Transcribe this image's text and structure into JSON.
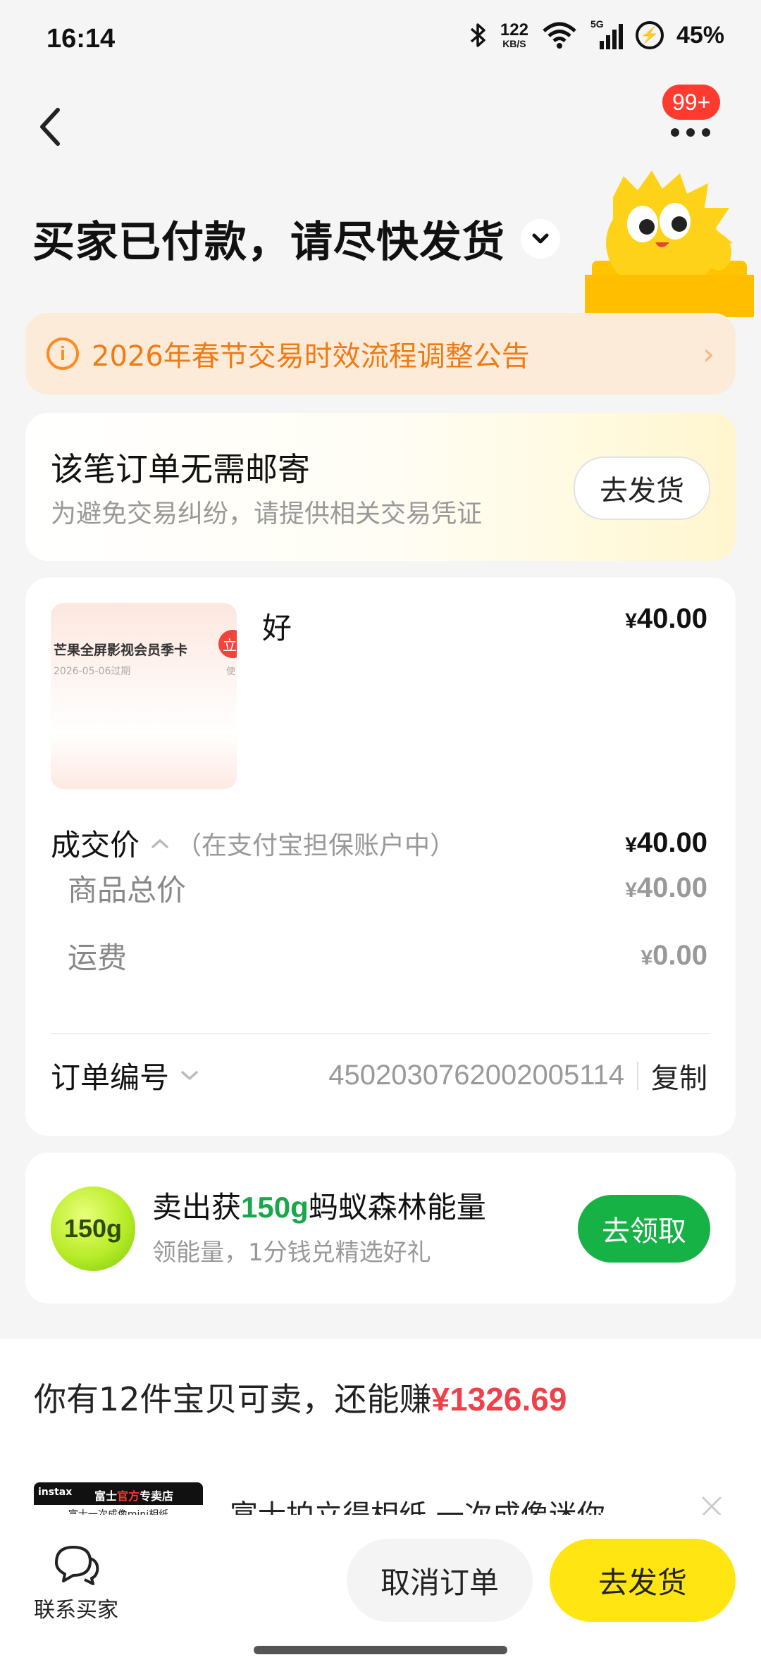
{
  "status_bar": {
    "time": "16:14",
    "net_speed_value": "122",
    "net_speed_unit": "KB/S",
    "network_tag": "5G",
    "battery": "45%"
  },
  "header": {
    "more_badge": "99+",
    "title": "买家已付款，请尽快发货"
  },
  "notice": {
    "text": "2026年春节交易时效流程调整公告"
  },
  "shipping": {
    "title": "该笔订单无需邮寄",
    "subtitle": "为避免交易纠纷，请提供相关交易凭证",
    "button": "去发货"
  },
  "order": {
    "thumb_title": "芒果全屏影视会员季卡",
    "thumb_date": "2026-05-06过期",
    "thumb_badge": "立",
    "thumb_side": "使",
    "item_name": "好",
    "item_price": "40.00",
    "yen": "¥",
    "deal_price_label": "成交价",
    "deal_price_note": "（在支付宝担保账户中）",
    "deal_price": "40.00",
    "goods_total_label": "商品总价",
    "goods_total": "40.00",
    "shipping_fee_label": "运费",
    "shipping_fee": "0.00",
    "order_no_label": "订单编号",
    "order_no": "4502030762002005114",
    "copy_label": "复制"
  },
  "energy": {
    "ball_text": "150g",
    "title_prefix": "卖出获",
    "title_highlight": "150g",
    "title_suffix": "蚂蚁森林能量",
    "subtitle": "领能量，1分钱兑精选好礼",
    "button": "去领取"
  },
  "recommend": {
    "hint_prefix": "你有12件宝贝可卖，还能赚",
    "hint_amount": "¥1326.69",
    "thumb_brand": "instax",
    "thumb_store_a": "富士",
    "thumb_store_b": "官方",
    "thumb_store_c": "专卖店",
    "thumb_caption": "富士一次成像mini相纸",
    "item_title": "富士拍立得相纸 一次成像迷你..."
  },
  "actions": {
    "contact_label": "联系买家",
    "cancel_label": "取消订单",
    "ship_label": "去发货"
  },
  "colors": {
    "accent_yellow": "#ffe511",
    "energy_green": "#17b246",
    "notice_orange": "#f07a13",
    "price_red": "#f0404a"
  }
}
